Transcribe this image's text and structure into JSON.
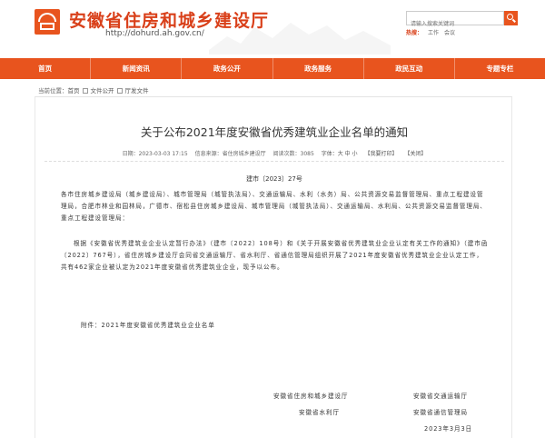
{
  "header": {
    "site_title": "安徽省住房和城乡建设厅",
    "site_url": "http://dohurd.ah.gov.cn/",
    "search": {
      "placeholder": "请输入搜索关键词"
    },
    "hot_label": "热搜：",
    "hot_words": [
      "工作",
      "会议"
    ]
  },
  "nav": {
    "items": [
      {
        "label": "首页"
      },
      {
        "label": "新闻资讯"
      },
      {
        "label": "政务公开"
      },
      {
        "label": "政务服务"
      },
      {
        "label": "政民互动"
      },
      {
        "label": "专题专栏"
      }
    ]
  },
  "breadcrumb": {
    "prefix": "当前位置：",
    "items": [
      "首页",
      "文件公开",
      "厅发文件"
    ],
    "separator": ">"
  },
  "article": {
    "title": "关于公布2021年度安徽省优秀建筑业企业名单的通知",
    "meta": {
      "date": "日期：2023-03-03 17:15",
      "source": "信息来源：省住房城乡建设厅",
      "views": "阅读次数：3085",
      "font_size": "字体：大 中 小",
      "print": "【我要打印】",
      "close": "【关闭】"
    },
    "doc_number": "建市〔2023〕27号",
    "paragraph_1": "各市住房城乡建设局（城乡建设局）、城市管理局（城管执法局）、交通运输局、水利（水务）局、公共资源交易监督管理局、重点工程建设管理局，合肥市林业和园林局，广德市、宿松县住房城乡建设局、城市管理局（城管执法局）、交通运输局、水利局、公共资源交易监督管理局、重点工程建设管理局：",
    "paragraph_2": "根据《安徽省优秀建筑业企业认定暂行办法》（建市〔2022〕108号）和《关于开展安徽省优秀建筑业企业认定有关工作的通知》（建市函〔2022〕767号），省住房城乡建设厅会同省交通运输厅、省水利厅、省通信管理局组织开展了2021年度安徽省优秀建筑业企业认定工作，共有462家企业被认定为2021年度安徽省优秀建筑业企业，现予以公布。",
    "attachment": "附件：2021年度安徽省优秀建筑业企业名单",
    "signatures": {
      "left_1": "安徽省住房和城乡建设厅",
      "left_2": "安徽省水利厅",
      "right_1": "安徽省交通运输厅",
      "right_2": "安徽省通信管理局",
      "date": "2023年3月3日"
    }
  },
  "colors": {
    "brand": "#e8541e",
    "title_red": "#d9401a"
  }
}
